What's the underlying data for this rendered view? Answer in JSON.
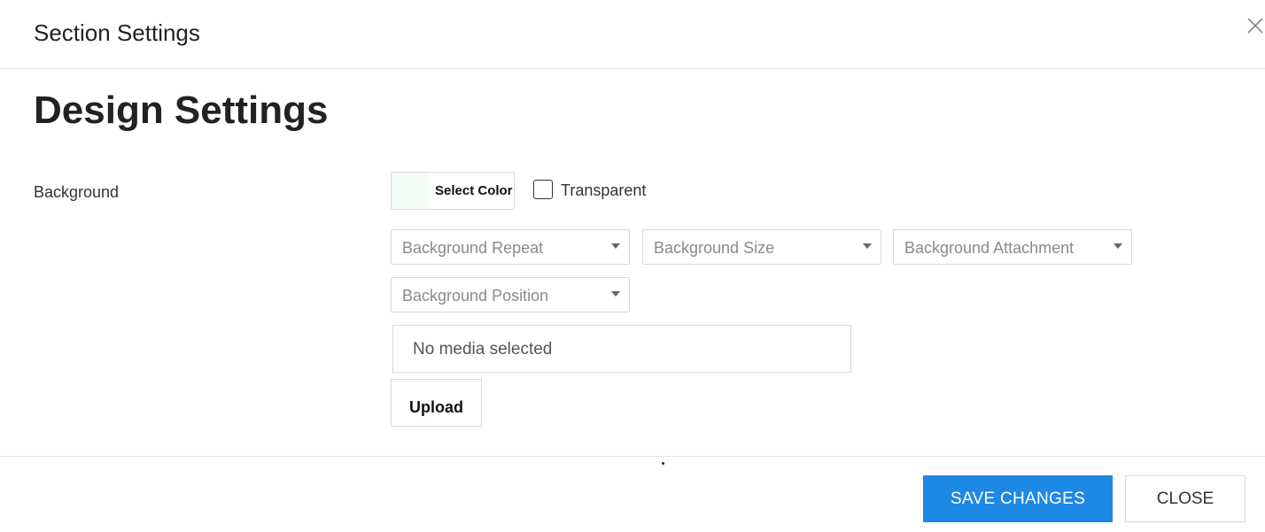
{
  "header": {
    "title": "Section Settings",
    "close_icon": "close-icon"
  },
  "main": {
    "heading": "Design Settings",
    "background": {
      "label": "Background",
      "color_button_label": "Select Color",
      "swatch_color": "#f3fcf5",
      "transparent_label": "Transparent",
      "transparent_checked": false,
      "selects": {
        "repeat_placeholder": "Background Repeat",
        "size_placeholder": "Background Size",
        "attachment_placeholder": "Background Attachment",
        "position_placeholder": "Background Position"
      },
      "media_status": "No media selected",
      "upload_label": "Upload"
    }
  },
  "footer": {
    "save_label": "SAVE CHANGES",
    "close_label": "CLOSE",
    "accent_color": "#1e88e5"
  }
}
